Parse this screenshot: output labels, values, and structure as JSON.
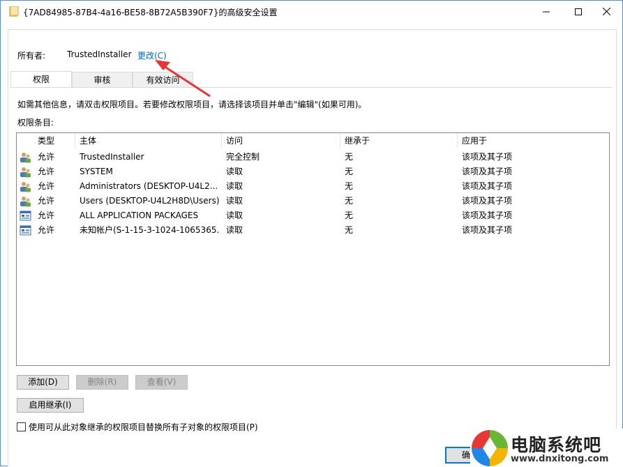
{
  "window": {
    "title": "{7AD84985-87B4-4a16-BE58-8B72A5B390F7}的高级安全设置",
    "minimize_glyph": "—",
    "maximize_glyph": "☐",
    "close_glyph": "✕"
  },
  "owner": {
    "label": "所有者:",
    "value": "TrustedInstaller",
    "change_link": "更改(C)"
  },
  "tabs": [
    {
      "label": "权限"
    },
    {
      "label": "审核"
    },
    {
      "label": "有效访问"
    }
  ],
  "info_text": "如需其他信息，请双击权限项目。若要修改权限项目，请选择该项目并单击\"编辑\"(如果可用)。",
  "entries_label": "权限条目:",
  "columns": [
    "类型",
    "主体",
    "访问",
    "继承于",
    "应用于"
  ],
  "rows": [
    {
      "icon": "group-users-icon",
      "type": "允许",
      "principal": "TrustedInstaller",
      "access": "完全控制",
      "inherited": "无",
      "applies": "该项及其子项"
    },
    {
      "icon": "group-users-icon",
      "type": "允许",
      "principal": "SYSTEM",
      "access": "读取",
      "inherited": "无",
      "applies": "该项及其子项"
    },
    {
      "icon": "group-users-icon",
      "type": "允许",
      "principal": "Administrators (DESKTOP-U4L2...",
      "access": "读取",
      "inherited": "无",
      "applies": "该项及其子项"
    },
    {
      "icon": "group-users-icon",
      "type": "允许",
      "principal": "Users (DESKTOP-U4L2H8D\\Users)",
      "access": "读取",
      "inherited": "无",
      "applies": "该项及其子项"
    },
    {
      "icon": "app-package-icon",
      "type": "允许",
      "principal": "ALL APPLICATION PACKAGES",
      "access": "读取",
      "inherited": "无",
      "applies": "该项及其子项"
    },
    {
      "icon": "app-package-icon",
      "type": "允许",
      "principal": "未知帐户(S-1-15-3-1024-1065365...",
      "access": "读取",
      "inherited": "无",
      "applies": "该项及其子项"
    }
  ],
  "buttons": {
    "add": "添加(D)",
    "remove": "删除(R)",
    "view": "查看(V)",
    "enable_inheritance": "启用继承(I)",
    "ok_partial": "确"
  },
  "replace_checkbox_label": "使用可从此对象继承的权限项目替换所有子对象的权限项目(P)",
  "watermark": {
    "text": "电脑系统吧",
    "url": "www.dnxitong.com"
  },
  "colors": {
    "link": "#0066cc",
    "arrow": "#e8353a",
    "focus_border": "#0078d7"
  }
}
